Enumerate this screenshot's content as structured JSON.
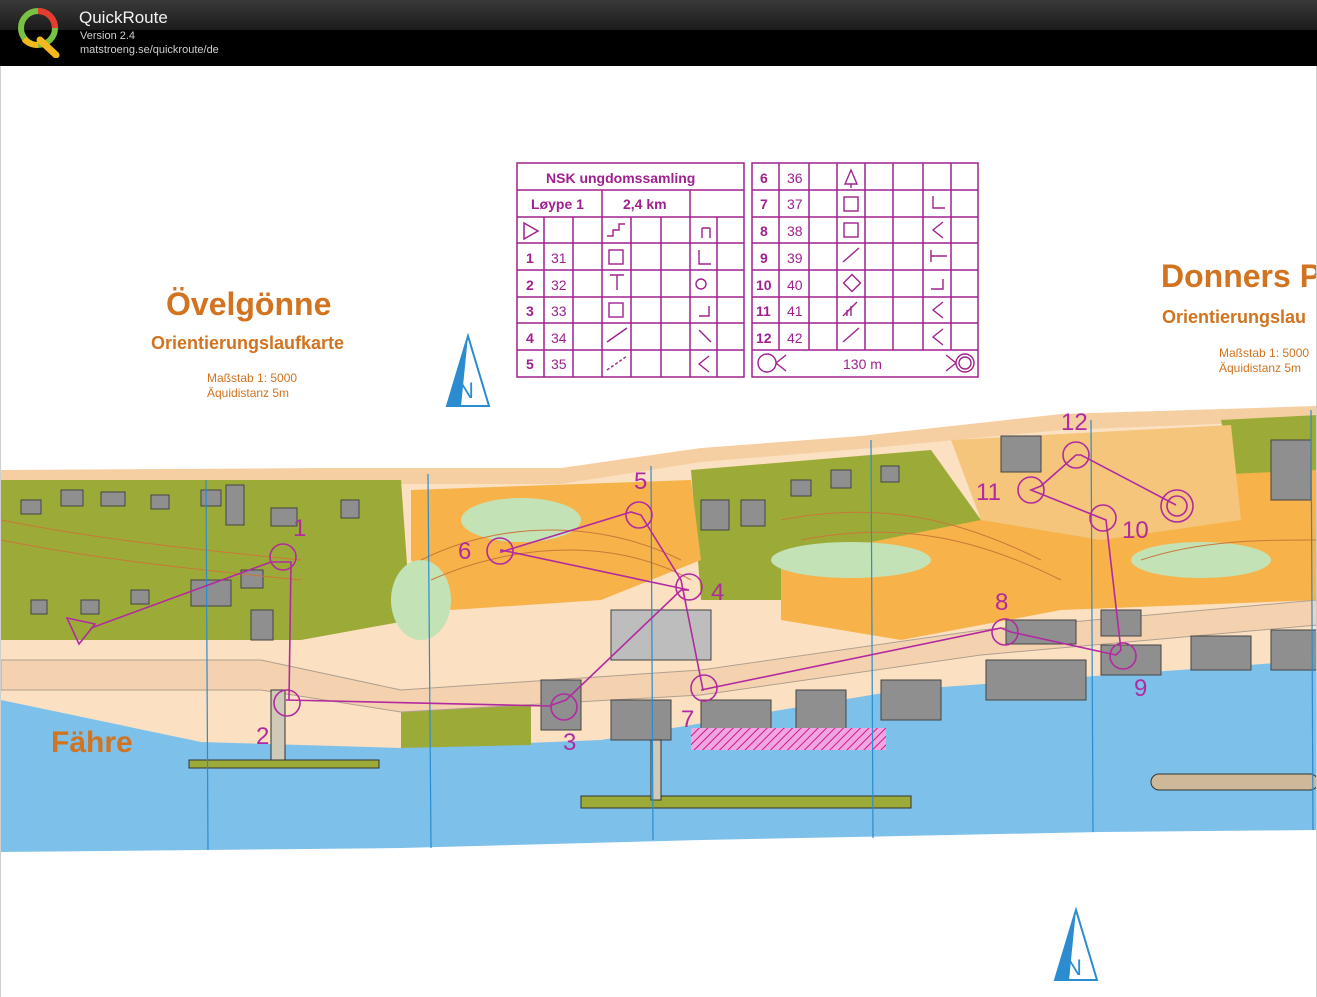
{
  "app": {
    "name": "QuickRoute",
    "version": "Version 2.4",
    "url": "matstroeng.se/quickroute/de"
  },
  "map": {
    "left_title": "Övelgönne",
    "left_subtitle": "Orientierungslaufkarte",
    "left_scale": "Maßstab 1: 5000",
    "left_equidistance": "Äquidistanz   5m",
    "right_title": "Donners P",
    "right_subtitle": "Orientierungslau",
    "right_scale": "Maßstab 1: 5000",
    "right_equidistance": "Äquidistanz   5m",
    "ferry_label": "Fähre",
    "north_label": "N",
    "course_color": "#b22aa0",
    "control_numbers": [
      "1",
      "2",
      "3",
      "4",
      "5",
      "6",
      "7",
      "8",
      "9",
      "10",
      "11",
      "12"
    ]
  },
  "description_sheet": {
    "event": "NSK ungdomssamling",
    "course": "Løype 1",
    "length": "2,4 km",
    "left_rows": [
      {
        "num": "1",
        "code": "31"
      },
      {
        "num": "2",
        "code": "32"
      },
      {
        "num": "3",
        "code": "33"
      },
      {
        "num": "4",
        "code": "34"
      },
      {
        "num": "5",
        "code": "35"
      }
    ],
    "right_rows": [
      {
        "num": "6",
        "code": "36"
      },
      {
        "num": "7",
        "code": "37"
      },
      {
        "num": "8",
        "code": "38"
      },
      {
        "num": "9",
        "code": "39"
      },
      {
        "num": "10",
        "code": "40"
      },
      {
        "num": "11",
        "code": "41"
      },
      {
        "num": "12",
        "code": "42"
      }
    ],
    "finish_distance": "130 m"
  }
}
